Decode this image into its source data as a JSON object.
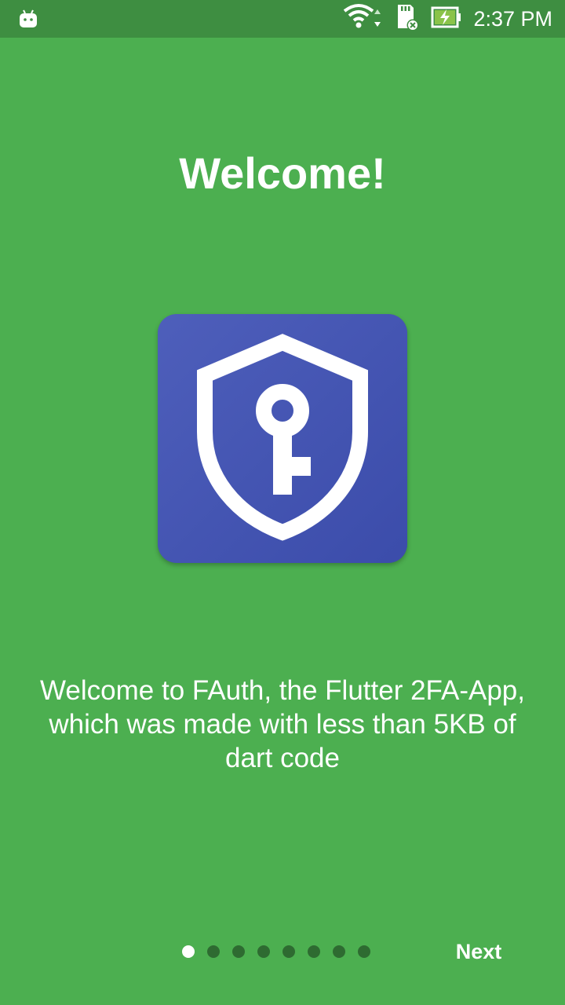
{
  "status_bar": {
    "time": "2:37 PM",
    "icons": [
      "android-icon",
      "wifi-icon",
      "sd-card-icon",
      "battery-charging-icon"
    ]
  },
  "onboarding": {
    "title": "Welcome!",
    "logo_icon": "shield-key-icon",
    "description": "Welcome to FAuth, the Flutter 2FA-App, which was made with less than 5KB of dart code",
    "page_count": 8,
    "current_page": 1,
    "next_label": "Next"
  },
  "colors": {
    "background": "#4CAF50",
    "status_bar": "#3E8E41",
    "logo_background": "#3F51B5",
    "dot_inactive": "#2E6B31",
    "dot_active": "#FFFFFF"
  }
}
